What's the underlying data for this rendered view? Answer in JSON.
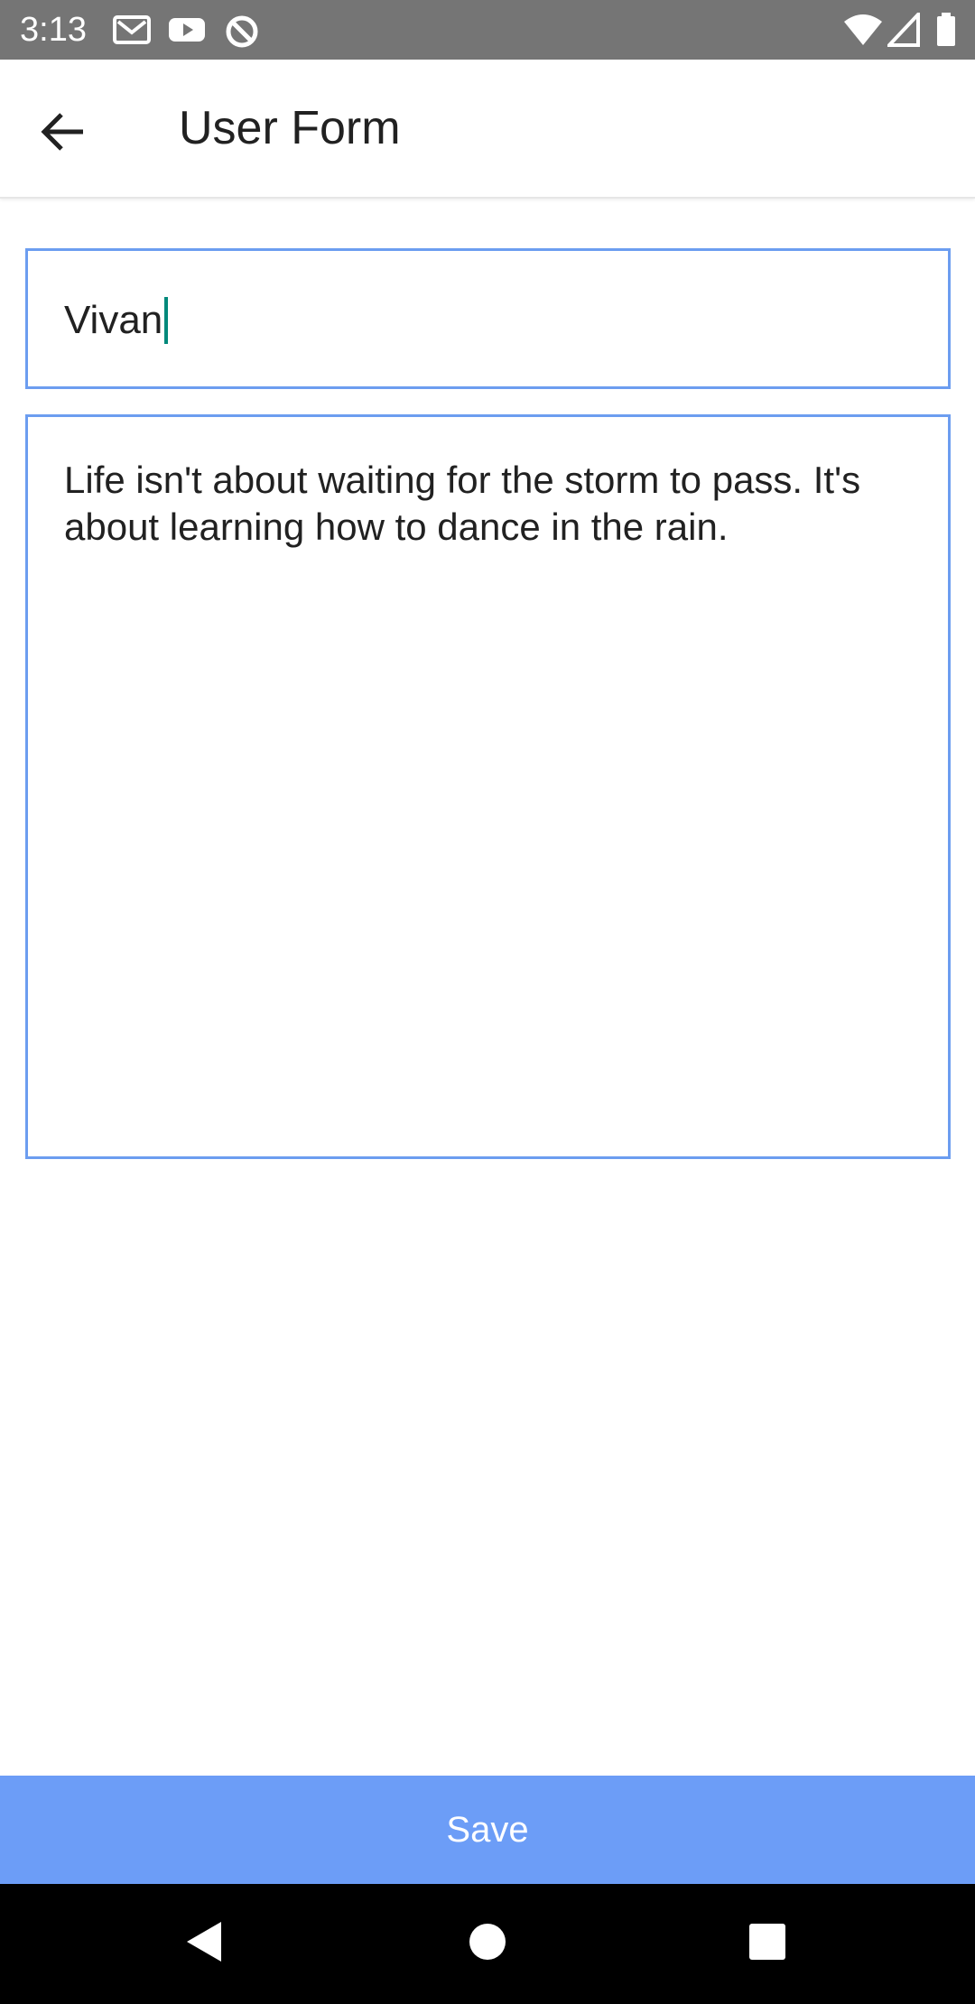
{
  "status_bar": {
    "time": "3:13",
    "left_icons": [
      "gmail-icon",
      "youtube-icon",
      "data-saver-icon"
    ],
    "right_icons": [
      "wifi-icon",
      "signal-icon",
      "battery-icon"
    ]
  },
  "app_bar": {
    "title": "User Form",
    "back_icon": "arrow-back-icon"
  },
  "form": {
    "name_value": "Vivan",
    "message_value": "Life isn't about waiting for the storm to pass. It's about learning how to dance in the rain."
  },
  "actions": {
    "save_label": "Save"
  },
  "nav": {
    "icons": [
      "back-triangle-icon",
      "home-circle-icon",
      "recents-square-icon"
    ]
  },
  "colors": {
    "status_bar": "#757575",
    "accent_border": "#6c9df0",
    "save_button": "#6c9df7",
    "caret": "#00897b"
  }
}
